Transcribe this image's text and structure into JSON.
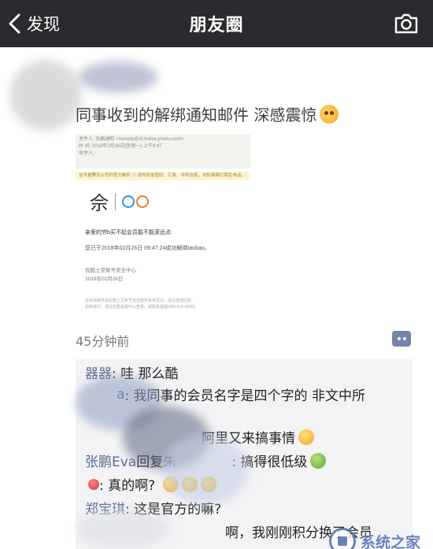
{
  "navbar": {
    "back_label": "发现",
    "title": "朋友圈",
    "camera_icon": "camera-icon"
  },
  "post": {
    "headline": "同事收到的解绑通知邮件 深感震惊",
    "timestamp": "45分钟前",
    "email": {
      "from_line": "发件人: 优酷通知 <noreply@id-notice.youku.com>",
      "time_line": "时  间: 2018年2月26日(星期一) 上午9:47",
      "to_line": "收件人:",
      "warning": "这不是腾讯公司的官方邮件 ①  请勿轻信密码、汇款、中奖信息，勿轻易拨打陌生电话。",
      "greeting": "亲爱的穷b买不起会员能不能滚远点:",
      "body": "您已于2018年02月26日 09:47:24成功解绑taobao。",
      "sign_1": "优酷土豆账号安全中心",
      "sign_2": "2018年02月26日",
      "footer_1": "此系统邮件由优酷土豆账号安全服务系统发出，请勿直接回复。",
      "footer_2": "如有疑问，请在优酷客服中心查看。或联系客服(400-810-0580)。"
    }
  },
  "comments": [
    {
      "name": "器器",
      "text": ": 哇 那么酷"
    },
    {
      "name": "a",
      "text": ": 我同事的会员名字是四个字的 非文中所"
    },
    {
      "name": "",
      "text": "阿里又来搞事情"
    },
    {
      "name": "张鹏Eva",
      "text": "回复",
      "target": "朱",
      "text2": ": 搞得很低级"
    },
    {
      "name": "",
      "text": ": 真的啊?"
    },
    {
      "name": "郑宝琪",
      "text": ": 这是官方的嘛?"
    },
    {
      "name": "",
      "text": "啊，我刚刚积分换了会员"
    }
  ],
  "watermark": "系统之家"
}
